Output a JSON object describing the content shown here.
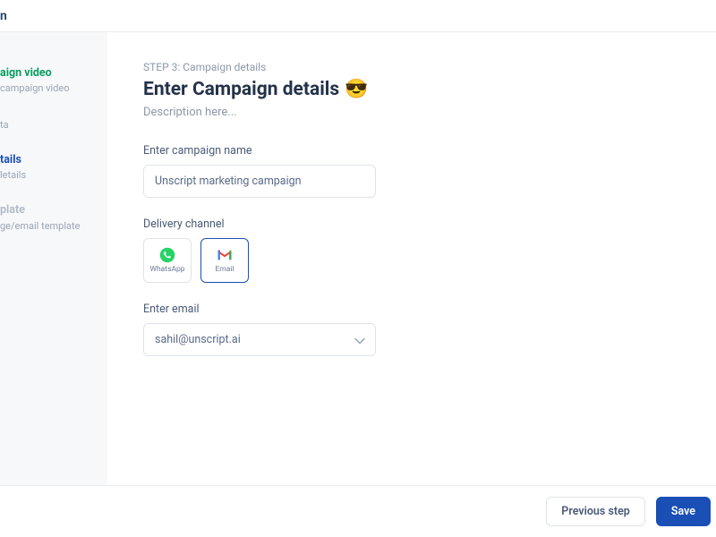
{
  "header": {
    "title_suffix": "n"
  },
  "sidebar": {
    "steps": [
      {
        "title_suffix": "aign video",
        "sub_suffix": "campaign video"
      },
      {
        "title_suffix": "",
        "sub_suffix": "ta"
      },
      {
        "title_suffix": "tails",
        "sub_suffix": "letails"
      },
      {
        "title_suffix": "plate",
        "sub_suffix": "ge/email template"
      }
    ]
  },
  "main": {
    "step_label": "STEP 3: Campaign details",
    "title": "Enter Campaign details",
    "emoji": "😎",
    "description": "Description here...",
    "campaign_name_label": "Enter campaign name",
    "campaign_name_value": "Unscript marketing campaign",
    "delivery_label": "Delivery channel",
    "channels": [
      {
        "label": "WhatsApp",
        "selected": false
      },
      {
        "label": "Email",
        "selected": true
      }
    ],
    "email_label": "Enter email",
    "email_value": "sahil@unscript.ai"
  },
  "footer": {
    "prev_label": "Previous step",
    "save_label": "Save"
  }
}
